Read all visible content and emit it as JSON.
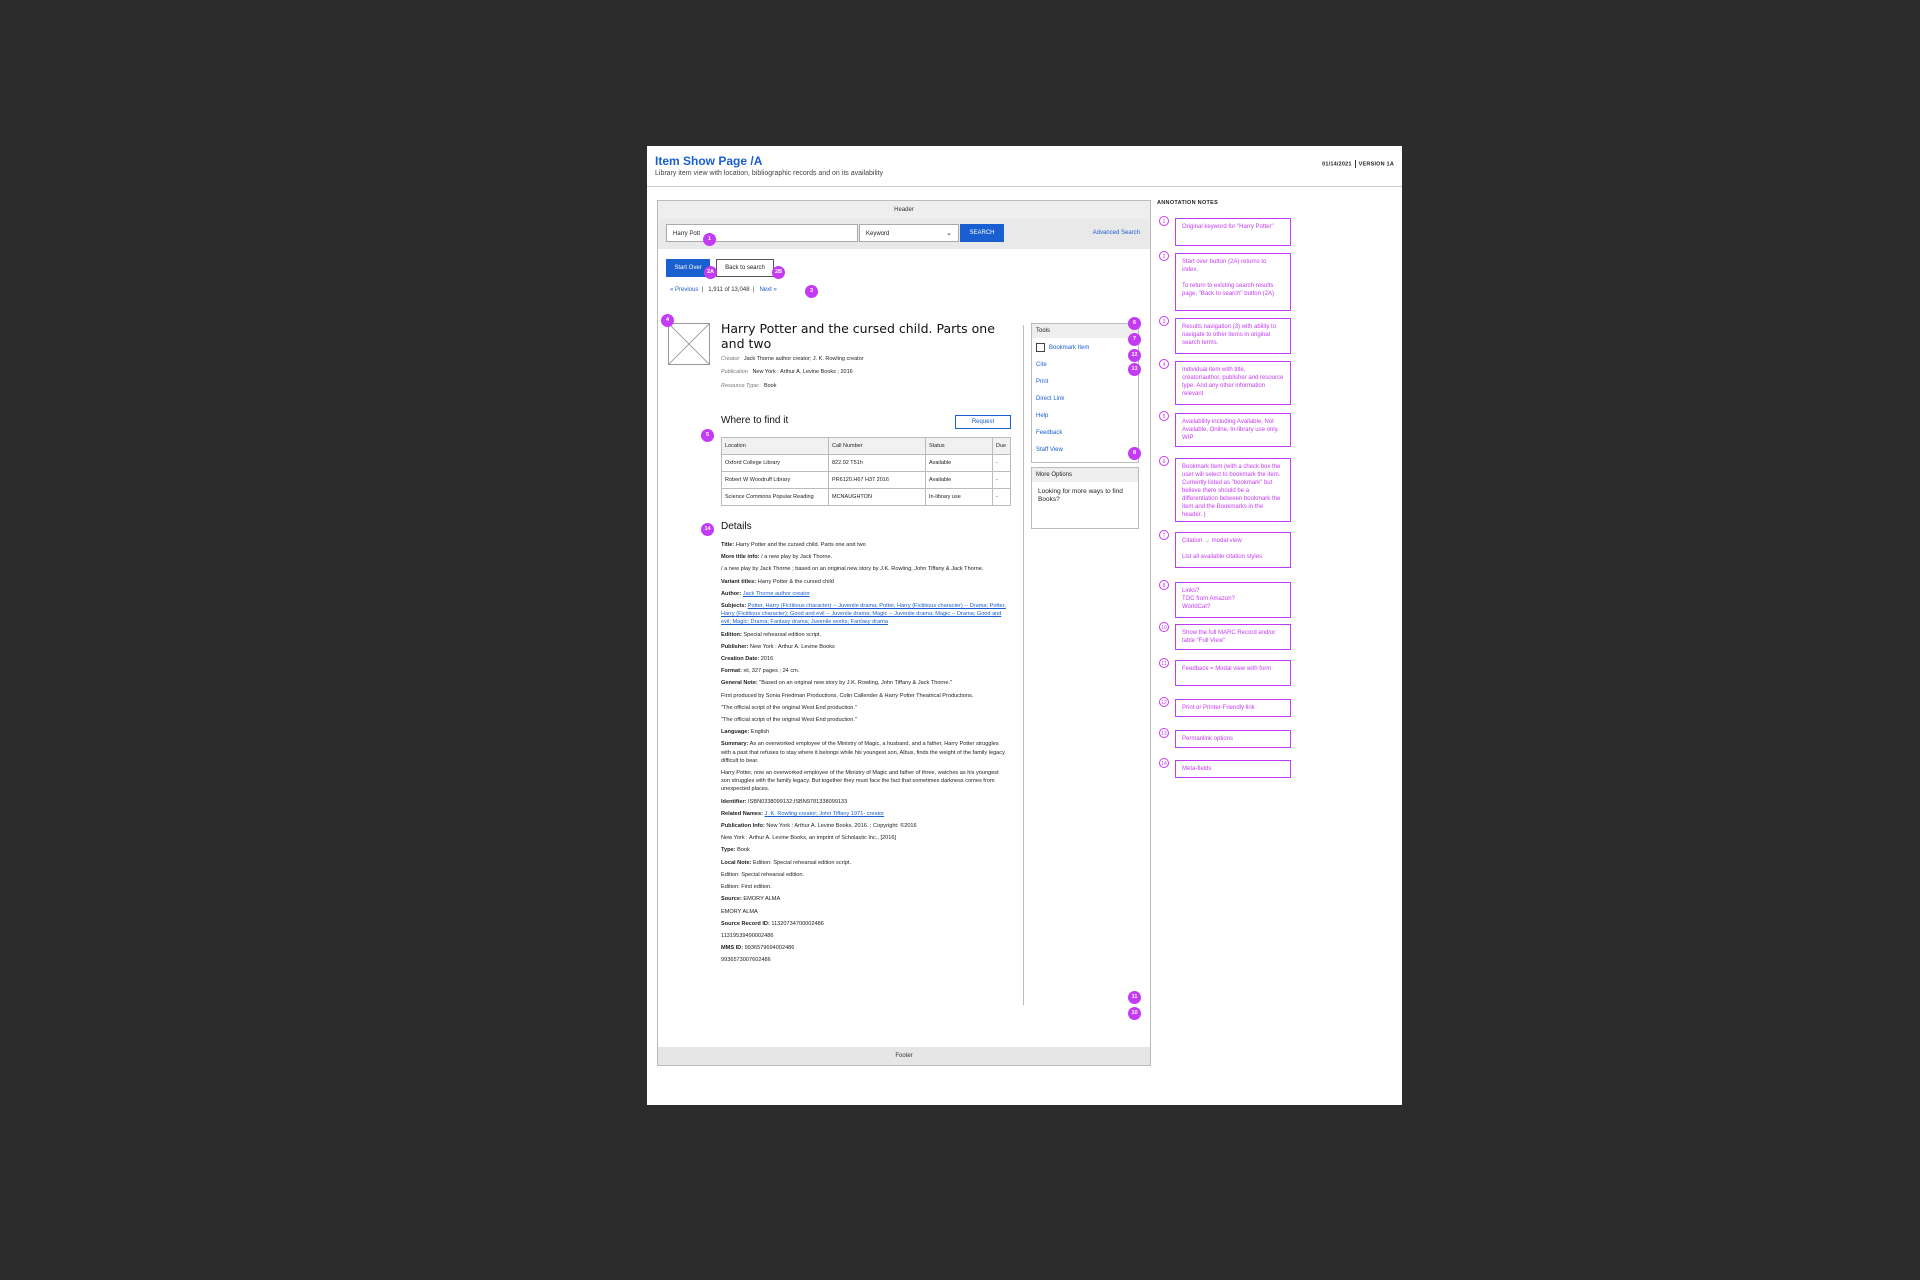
{
  "sheet": {
    "title": "Item Show Page /A",
    "subtitle": "Library item view with location, bibliographic records and on its availability",
    "date": "01/14/2021",
    "version": "VERSION 1A",
    "notes_title": "ANNOTATION NOTES"
  },
  "wireframe": {
    "header_label": "Header",
    "footer_label": "Footer",
    "search": {
      "query": "Harry Pott",
      "field": "Keyword",
      "button": "SEARCH",
      "advanced": "Advanced Search"
    },
    "start_over": "Start Over",
    "back_to_search": "Back to search",
    "results_nav": {
      "previous": "« Previous",
      "position": "1,911",
      "of": "of",
      "total": "13,048",
      "next": "Next »"
    },
    "item": {
      "title": "Harry Potter and the cursed child. Parts one and two",
      "creator_label": "Creator",
      "creator": "Jack Thorne author creator; J. K. Rowling creator",
      "publication_label": "Publication",
      "publication": "New York : Arthur A. Levine Books ; 2016",
      "resource_label": "Resource Type:",
      "resource": "Book"
    },
    "where": {
      "title": "Where to find it",
      "request": "Request",
      "columns": [
        "Location",
        "Call Number",
        "Status",
        "Due"
      ],
      "rows": [
        [
          "Oxford College Library",
          "822.92 T51h",
          "Available",
          "-"
        ],
        [
          "Robert W Woodruff Library",
          "PR6120.H67 H37 2016",
          "Available",
          "-"
        ],
        [
          "Science Commons Popular Reading",
          "MCNAUGHTON",
          "In-library use",
          "-"
        ]
      ]
    },
    "details": {
      "title": "Details",
      "rows": [
        {
          "label": "Title:",
          "value": "Harry Potter and the cursed child. Parts one and two"
        },
        {
          "label": "More title info:",
          "value": "/ a new play by Jack Thorne."
        },
        {
          "label": "",
          "value": "/ a new play by Jack Thorne ; based on an original new story by J.K. Rowling, John Tiffany & Jack Thorne."
        },
        {
          "label": "Variant titles:",
          "value": "Harry Potter & the cursed child"
        },
        {
          "label": "Author:",
          "value": "Jack Thorne author creator",
          "link": true
        },
        {
          "label": "Subjects:",
          "value": "Potter, Harry (Fictitious character) -- Juvenile drama; Potter, Harry (Fictitious character) -- Drama; Potter, Harry (Fictitious character); Good and evil -- Juvenile drama; Magic -- Juvenile drama; Magic -- Drama; Good and evil; Magic; Drama; Fantasy drama; Juvenile works; Fantasy drama",
          "link": true
        },
        {
          "label": "Edition:",
          "value": "Special rehearsal edition script."
        },
        {
          "label": "Publisher:",
          "value": "New York : Arthur A. Levine Books"
        },
        {
          "label": "Creation Date:",
          "value": "2016"
        },
        {
          "label": "Format:",
          "value": "xii, 327 pages ; 24 cm."
        },
        {
          "label": "General Note:",
          "value": "\"Based on an original new story by J.K. Rowling, John Tiffany & Jack Thorne.\""
        },
        {
          "label": "",
          "value": "First produced by Sonia Friedman Productions, Colin Callender & Harry Potter Theatrical Productions."
        },
        {
          "label": "",
          "value": "\"The official script of the original West End production.\""
        },
        {
          "label": "",
          "value": "\"The official script of the original West End production.\""
        },
        {
          "label": "Language:",
          "value": "English"
        },
        {
          "label": "Summary:",
          "value": "As an overworked employee of the Ministry of Magic, a husband, and a father, Harry Potter struggles with a past that refuses to stay where it belongs while his youngest son, Albus, finds the weight of the family legacy difficult to bear."
        },
        {
          "label": "",
          "value": "Harry Potter, now an overworked employee of the Ministry of Magic and father of three, watches as his youngest son struggles with the family legacy. But together they must face the fact that sometimes darkness comes from unexpected places."
        },
        {
          "label": "Identifier:",
          "value": "ISBN0338099132;ISBN9781338099133"
        },
        {
          "label": "Related Names:",
          "value": "J. K. Rowling creator; John Tiffany 1971- creator",
          "link": true
        },
        {
          "label": "Publication Info:",
          "value": "New York : Arthur A. Levine Books, 2016. ; Copyright: ©2016"
        },
        {
          "label": "",
          "value": "New York : Arthur A. Levine Books, an imprint of Scholastic Inc., [2016]"
        },
        {
          "label": "Type:",
          "value": "Book"
        },
        {
          "label": "Local Note:",
          "value": "Edition: Special rehearsal edition script."
        },
        {
          "label": "",
          "value": "Edition: Special rehearsal edition."
        },
        {
          "label": "",
          "value": "Edition: First edition."
        },
        {
          "label": "Source:",
          "value": "EMORY ALMA"
        },
        {
          "label": "",
          "value": "EMORY ALMA"
        },
        {
          "label": "Source Record ID:",
          "value": "11320734700002486"
        },
        {
          "label": "",
          "value": "11319539490002486"
        },
        {
          "label": "MMS ID:",
          "value": "9936579694002486"
        },
        {
          "label": "",
          "value": "9936573007602486"
        }
      ]
    },
    "tools": {
      "title": "Tools",
      "bookmark": "Bookmark Item",
      "items": [
        "Cite",
        "Print",
        "Direct Link",
        "Help",
        "Feedback",
        "Staff View"
      ]
    },
    "more_options": {
      "title": "More Options",
      "text": "Looking for more ways to find Books?"
    },
    "markers": {
      "m1": "1",
      "m2": "2A",
      "m2b": "2B",
      "m3": "3",
      "m4": "4",
      "m5": "5",
      "m14": "14",
      "m6": "6",
      "m7": "7",
      "m12": "12",
      "m13": "13",
      "m8": "8",
      "m11": "11",
      "m10": "10"
    }
  },
  "annotations": [
    {
      "num": "1",
      "text": "Original keyword for \"Harry Potter\""
    },
    {
      "num": "2",
      "text": "Start over button (2A) returns to index.\n\nTo return to existing search results page, \"Back to search\" button (2A)"
    },
    {
      "num": "3",
      "text": "Results navigation (3) with ability to navigate to other items in original search terms."
    },
    {
      "num": "4",
      "text": "Individual item with title, creator/author, publisher and resource type. And any other information relevant"
    },
    {
      "num": "5",
      "text": "Availability including Available, Not Available, Online, In-library use only. WIP"
    },
    {
      "num": "6",
      "text": "Bookmark Item (with a check box the user will select to bookmark the item. Currently listed as \"bookmark\" but believe there should be a differentiation between bookmark the item and the Bookmarks in the header. )"
    },
    {
      "num": "7",
      "text": "Citation → modal view\n\nList all available citation styles"
    },
    {
      "num": "8",
      "text": "Links?\nTOC from Amazon?\nWorldCat?"
    },
    {
      "num": "10",
      "text": "Show the full MARC Record and/or table \"Full View\""
    },
    {
      "num": "11",
      "text": "Feedback = Modal view with form"
    },
    {
      "num": "12",
      "text": "Print or Printer-Friendly link"
    },
    {
      "num": "13",
      "text": "Permanlink options"
    },
    {
      "num": "14",
      "text": "Meta-fields"
    }
  ]
}
